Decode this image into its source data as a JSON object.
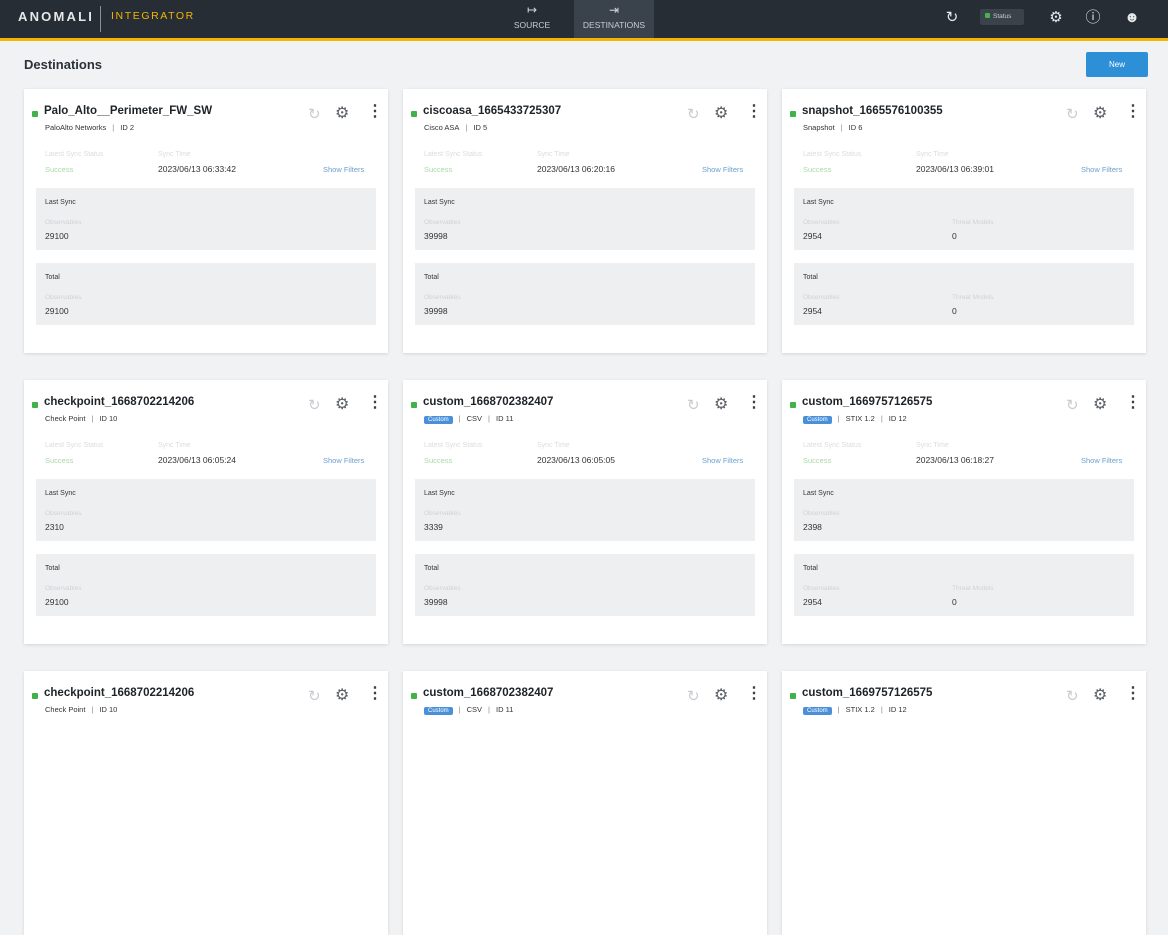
{
  "header": {
    "brand": "ANOMALI",
    "product": "INTEGRATOR",
    "tabs": [
      {
        "label": "SOURCE",
        "icon": "source-arrow-icon"
      },
      {
        "label": "DESTINATIONS",
        "icon": "destination-arrow-icon"
      }
    ],
    "status_label": "Status",
    "accent_color": "#f4b400"
  },
  "page": {
    "title": "Destinations",
    "new_button": "New"
  },
  "labels": {
    "latest_sync_status": "Latest Sync Status",
    "sync_time": "Sync Time",
    "show_filters": "Show Filters",
    "last_sync": "Last Sync",
    "total": "Total",
    "observables": "Observables",
    "threat_models": "Threat Models"
  },
  "cards": [
    {
      "name": "Palo_Alto__Perimeter_FW_SW",
      "vendor": "PaloAlto Networks",
      "badge": "",
      "format": "",
      "id": "ID 2",
      "status": "Success",
      "sync_time": "2023/06/13 06:33:42",
      "last_obs": "29100",
      "last_tm": "",
      "total_obs": "29100",
      "total_tm": ""
    },
    {
      "name": "ciscoasa_1665433725307",
      "vendor": "Cisco ASA",
      "badge": "",
      "format": "",
      "id": "ID 5",
      "status": "Success",
      "sync_time": "2023/06/13 06:20:16",
      "last_obs": "39998",
      "last_tm": "",
      "total_obs": "39998",
      "total_tm": ""
    },
    {
      "name": "snapshot_1665576100355",
      "vendor": "Snapshot",
      "badge": "",
      "format": "",
      "id": "ID 6",
      "status": "Success",
      "sync_time": "2023/06/13 06:39:01",
      "last_obs": "2954",
      "last_tm": "0",
      "total_obs": "2954",
      "total_tm": "0"
    },
    {
      "name": "checkpoint_1668702214206",
      "vendor": "Check Point",
      "badge": "",
      "format": "",
      "id": "ID 10",
      "status": "Success",
      "sync_time": "2023/06/13 06:05:24",
      "last_obs": "2310",
      "last_tm": "",
      "total_obs": "29100",
      "total_tm": ""
    },
    {
      "name": "custom_1668702382407",
      "vendor": "",
      "badge": "Custom",
      "format": "CSV",
      "id": "ID 11",
      "status": "Success",
      "sync_time": "2023/06/13 06:05:05",
      "last_obs": "3339",
      "last_tm": "",
      "total_obs": "39998",
      "total_tm": ""
    },
    {
      "name": "custom_1669757126575",
      "vendor": "",
      "badge": "Custom",
      "format": "STIX 1.2",
      "id": "ID 12",
      "status": "Success",
      "sync_time": "2023/06/13 06:18:27",
      "last_obs": "2398",
      "last_tm": "",
      "total_obs": "2954",
      "total_tm": "0"
    },
    {
      "name": "checkpoint_1668702214206",
      "vendor": "Check Point",
      "badge": "",
      "format": "",
      "id": "ID 10",
      "status": "",
      "sync_time": "",
      "last_obs": "",
      "last_tm": "",
      "total_obs": "",
      "total_tm": ""
    },
    {
      "name": "custom_1668702382407",
      "vendor": "",
      "badge": "Custom",
      "format": "CSV",
      "id": "ID 11",
      "status": "",
      "sync_time": "",
      "last_obs": "",
      "last_tm": "",
      "total_obs": "",
      "total_tm": ""
    },
    {
      "name": "custom_1669757126575",
      "vendor": "",
      "badge": "Custom",
      "format": "STIX 1.2",
      "id": "ID 12",
      "status": "",
      "sync_time": "",
      "last_obs": "",
      "last_tm": "",
      "total_obs": "",
      "total_tm": ""
    }
  ]
}
